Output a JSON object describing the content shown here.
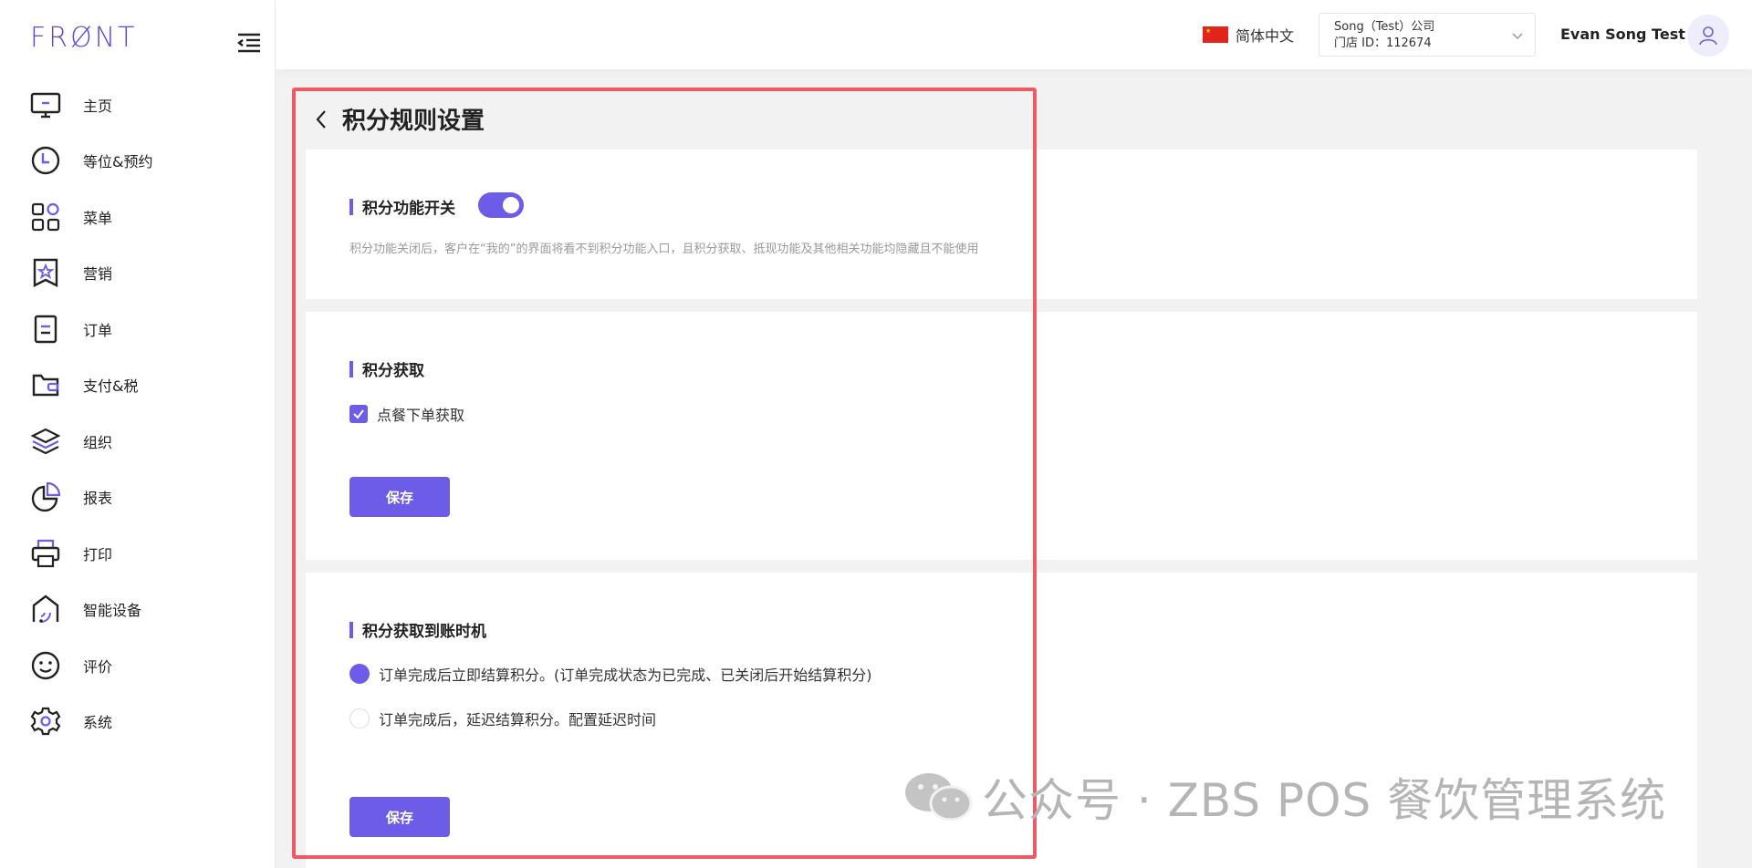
{
  "sidebar": {
    "logo": "FRØNT",
    "items": [
      {
        "label": "主页",
        "icon": "monitor-icon"
      },
      {
        "label": "等位&预约",
        "icon": "clock-icon"
      },
      {
        "label": "菜单",
        "icon": "grid-icon"
      },
      {
        "label": "营销",
        "icon": "star-bookmark-icon"
      },
      {
        "label": "订单",
        "icon": "document-icon"
      },
      {
        "label": "支付&税",
        "icon": "wallet-icon"
      },
      {
        "label": "组织",
        "icon": "layers-icon"
      },
      {
        "label": "报表",
        "icon": "pie-chart-icon"
      },
      {
        "label": "打印",
        "icon": "printer-icon"
      },
      {
        "label": "智能设备",
        "icon": "smart-home-icon"
      },
      {
        "label": "评价",
        "icon": "smiley-icon"
      },
      {
        "label": "系统",
        "icon": "gear-icon"
      }
    ]
  },
  "header": {
    "language": "简体中文",
    "store_name": "Song（Test）公司",
    "store_id": "门店 ID：112674",
    "user_name": "Evan Song Test"
  },
  "page": {
    "title": "积分规则设置"
  },
  "points_switch": {
    "title": "积分功能开关",
    "enabled": true,
    "description": "积分功能关闭后，客户在“我的”的界面将看不到积分功能入口，且积分获取、抵现功能及其他相关功能均隐藏且不能使用"
  },
  "points_earn": {
    "title": "积分获取",
    "option_label": "点餐下单获取",
    "checked": true,
    "save_label": "保存"
  },
  "points_timing": {
    "title": "积分获取到账时机",
    "options": [
      {
        "label": "订单完成后立即结算积分。(订单完成状态为已完成、已关闭后开始结算积分)",
        "selected": true
      },
      {
        "label": "订单完成后，延迟结算积分。配置延迟时间",
        "selected": false
      }
    ],
    "save_label": "保存"
  },
  "watermark": "公众号 · ZBS POS 餐饮管理系统",
  "colors": {
    "accent": "#6c5ce7",
    "highlight": "#ee5a64"
  }
}
